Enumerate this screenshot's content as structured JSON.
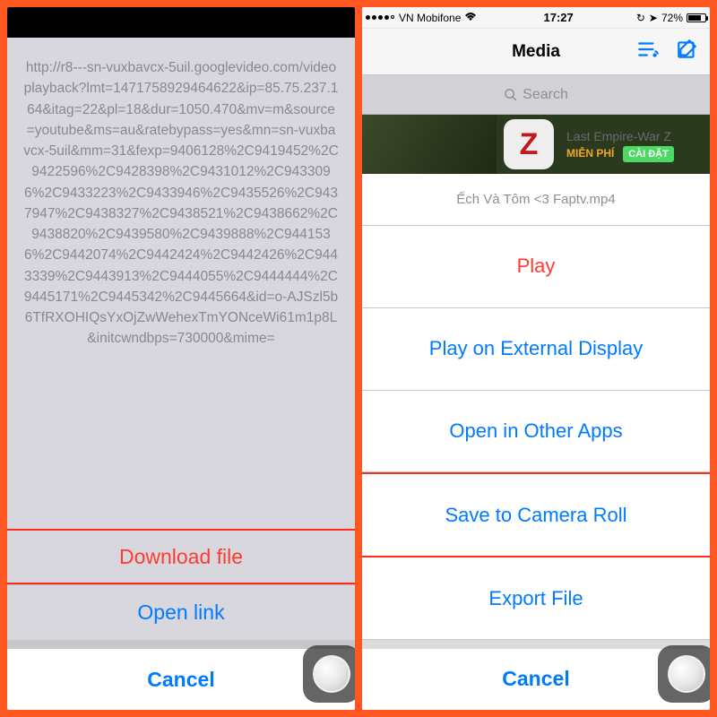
{
  "left": {
    "url_text": "http://r8---sn-vuxbavcx-5uil.googlevideo.com/videoplayback?lmt=1471758929464622&ip=85.75.237.164&itag=22&pl=18&dur=1050.470&mv=m&source=youtube&ms=au&ratebypass=yes&mn=sn-vuxbavcx-5uil&mm=31&fexp=9406128%2C9419452%2C9422596%2C9428398%2C9431012%2C9433096%2C9433223%2C9433946%2C9435526%2C9437947%2C9438327%2C9438521%2C9438662%2C9438820%2C9439580%2C9439888%2C9441536%2C9442074%2C9442424%2C9442426%2C9443339%2C9443913%2C9444055%2C9444444%2C9445171%2C9445342%2C9445664&id=o-AJSzl5b6TfRXOHIQsYxOjZwWehexTmYONceWi61m1p8L&initcwndbps=730000&mime=",
    "download_label": "Download file",
    "open_label": "Open link",
    "cancel_label": "Cancel"
  },
  "right": {
    "statusbar": {
      "carrier": "VN Mobifone",
      "time": "17:27",
      "battery": "72%"
    },
    "nav": {
      "title": "Media"
    },
    "search": {
      "placeholder": "Search"
    },
    "ad": {
      "icon_letter": "Z",
      "title": "Last Empire-War Z",
      "free": "MIỄN PHÍ",
      "install": "CÀI ĐẶT"
    },
    "file_title": "Ếch Và Tôm <3 Faptv.mp4",
    "actions": {
      "play": "Play",
      "external": "Play on External Display",
      "open_apps": "Open in Other Apps",
      "save_roll": "Save to Camera Roll",
      "export": "Export File",
      "cancel": "Cancel"
    }
  }
}
